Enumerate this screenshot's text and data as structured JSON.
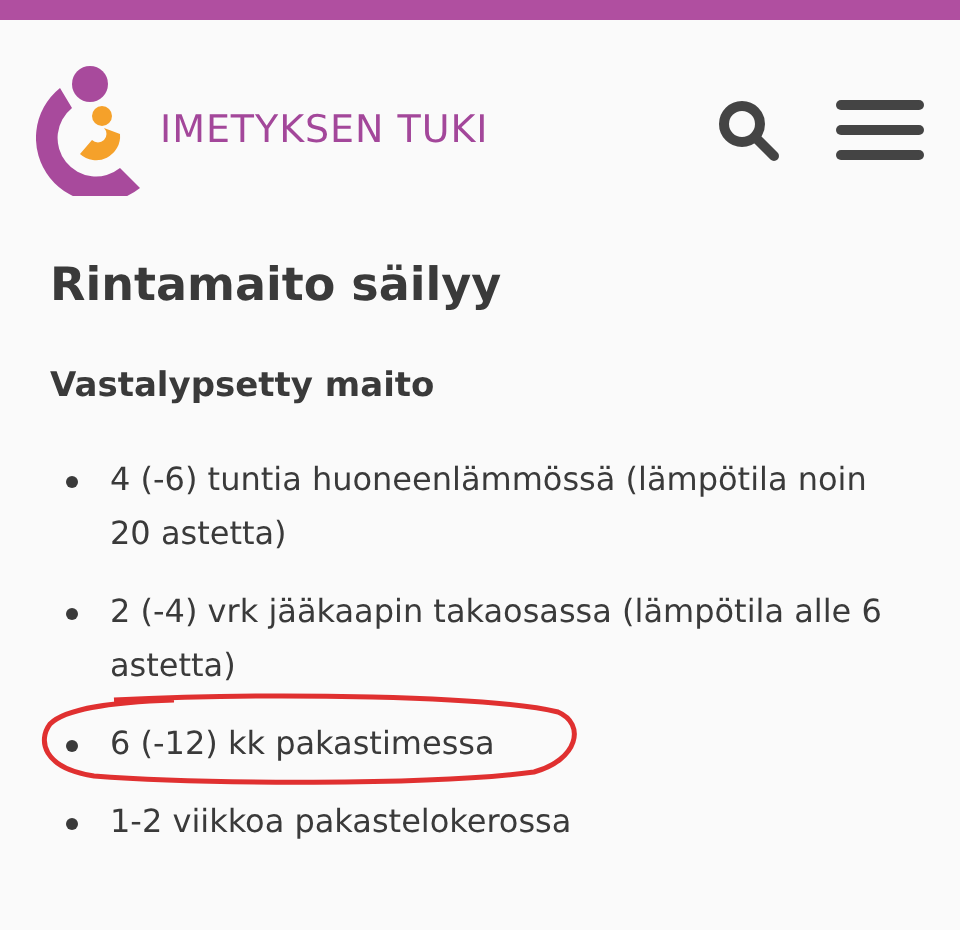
{
  "header": {
    "brand": "IMETYKSEN TUKI"
  },
  "article": {
    "title": "Rintamaito säilyy",
    "section": "Vastalypsetty maito",
    "items": [
      {
        "text": "4 (-6) tuntia huoneenlämmössä (lämpötila noin 20 astetta)",
        "circled": false
      },
      {
        "text": "2 (-4) vrk jääkaapin takaosassa (lämpötila alle 6 astetta)",
        "circled": false
      },
      {
        "text": "6 (-12) kk pakastimessa",
        "circled": true
      },
      {
        "text": "1-2 viikkoa pakastelokerossa",
        "circled": false
      }
    ]
  }
}
